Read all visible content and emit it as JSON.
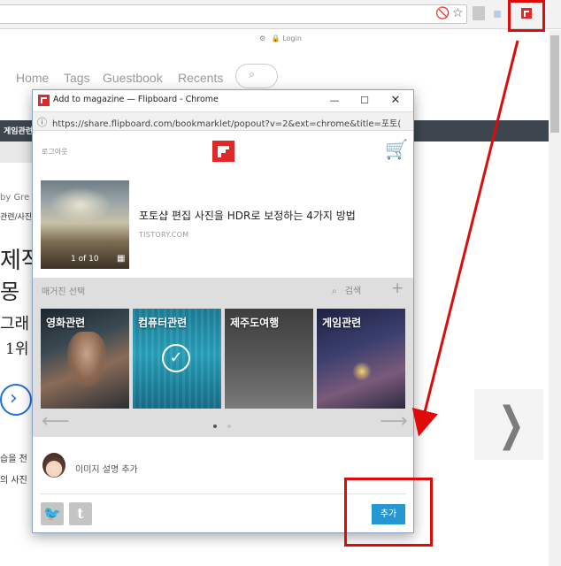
{
  "browser": {
    "omnibox_url": "",
    "extension_icon": "flipboard-icon"
  },
  "blog": {
    "login_label": "Login",
    "nav": [
      "Home",
      "Tags",
      "Guestbook",
      "Recents"
    ],
    "category_bar_label": "게임관련",
    "side_text_by": "by Gre",
    "side_text_path": "관련/사진",
    "side_big_1": "제작",
    "side_big_2": "몽",
    "side_big_3": "그래",
    "side_big_4": "1위",
    "side_small_1": "습을 전",
    "side_small_2": "의 사진",
    "colors": {
      "category_bar": "#3d464e",
      "blue_circle": "#1e6fd9"
    }
  },
  "popup": {
    "window_title": "Add to magazine — Flipboard - Chrome",
    "url": "https://share.flipboard.com/bookmarklet/popout?v=2&ext=chrome&title=포토(",
    "logout_label": "로그아웃",
    "article": {
      "title": "포토샵 편집 사진을 HDR로 보정하는 4가지 방법",
      "domain": "TISTORY.COM",
      "page_count": "1 of 10"
    },
    "magazine": {
      "label": "매거진 선택",
      "search_label": "검색",
      "add_icon": "plus-icon",
      "tiles": [
        {
          "name": "영화관련",
          "selected": false
        },
        {
          "name": "컴퓨터관련",
          "selected": true
        },
        {
          "name": "제주도여행",
          "selected": false
        },
        {
          "name": "게임관련",
          "selected": false
        }
      ],
      "page_dots": 2,
      "active_dot": 1
    },
    "caption_placeholder": "이미지 설명 추가",
    "add_button_label": "추가",
    "social": [
      "twitter-icon",
      "tumblr-icon"
    ],
    "colors": {
      "brand": "#e12828",
      "button": "#2598d3",
      "annotation": "#e10a0a"
    }
  }
}
